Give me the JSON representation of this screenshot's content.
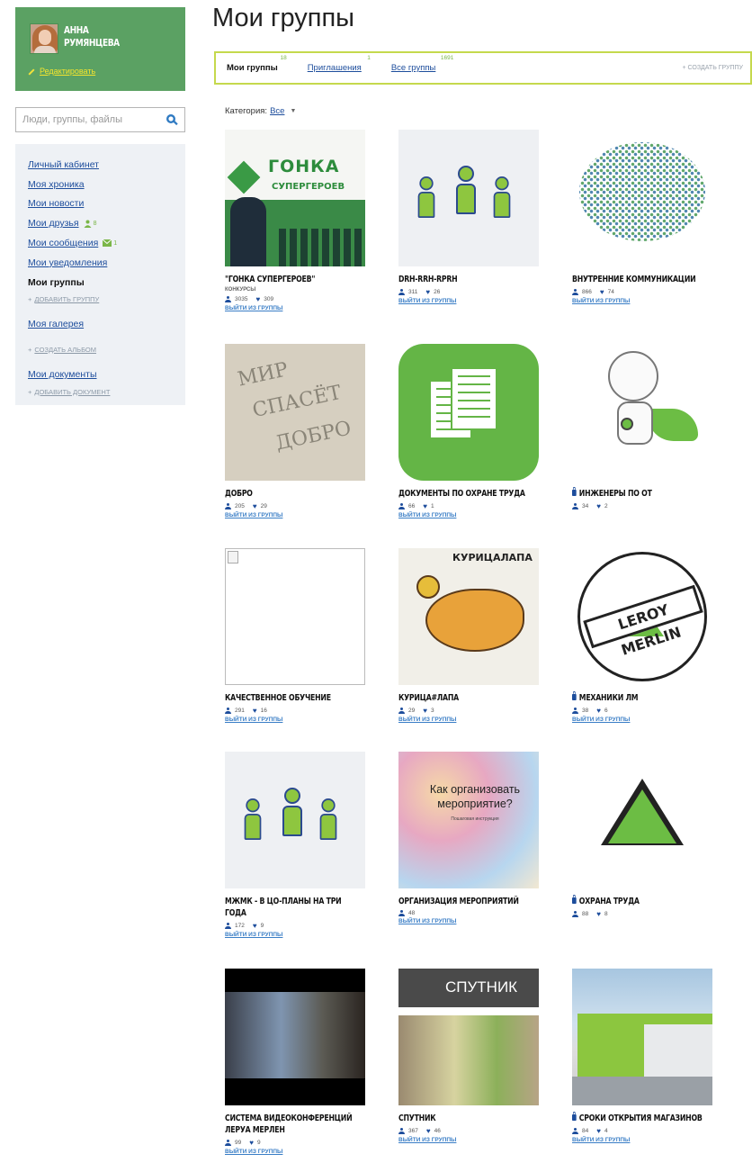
{
  "profile": {
    "name_line1": "АННА",
    "name_line2": "РУМЯНЦЕВА",
    "edit_label": "Редактировать"
  },
  "search": {
    "placeholder": "Люди, группы, файлы"
  },
  "nav": {
    "items": [
      {
        "label": "Личный кабинет"
      },
      {
        "label": "Моя хроника"
      },
      {
        "label": "Мои новости"
      },
      {
        "label": "Мои друзья",
        "badge": "8"
      },
      {
        "label": "Мои сообщения",
        "badge": "1"
      },
      {
        "label": "Мои уведомления"
      },
      {
        "label": "Мои группы"
      }
    ],
    "add_group": "добавить группу",
    "gallery": "Моя галерея",
    "create_album": "создать альбом",
    "documents": "Мои документы",
    "add_document": "добавить документ"
  },
  "page": {
    "title": "Мои группы"
  },
  "tabs": {
    "items": [
      {
        "label": "Мои группы",
        "count": "18"
      },
      {
        "label": "Приглашения",
        "count": "1"
      },
      {
        "label": "Все группы",
        "count": "1691"
      }
    ],
    "create": "+ создать группу"
  },
  "filter": {
    "label": "Категория:",
    "value": "Все"
  },
  "groups": [
    {
      "title": "\"Гонка супергероев\"",
      "subtitle": "конкурсы",
      "members": "3035",
      "likes": "309",
      "leave": "выйти из группы",
      "private": false
    },
    {
      "title": "DRH-RRH-RPRH",
      "members": "311",
      "likes": "26",
      "leave": "выйти из группы",
      "private": false
    },
    {
      "title": "Внутренние коммуникации",
      "members": "866",
      "likes": "74",
      "leave": "выйти из группы",
      "private": false
    },
    {
      "title": "Добро",
      "members": "205",
      "likes": "29",
      "leave": "выйти из группы",
      "private": false
    },
    {
      "title": "Документы по охране труда",
      "members": "66",
      "likes": "1",
      "leave": "выйти из группы",
      "private": false
    },
    {
      "title": "Инженеры по ОТ",
      "members": "34",
      "likes": "2",
      "private": true
    },
    {
      "title": "Качественное обучение",
      "members": "291",
      "likes": "16",
      "leave": "выйти из группы",
      "private": false
    },
    {
      "title": "Курица#лапа",
      "members": "29",
      "likes": "3",
      "leave": "выйти из группы",
      "private": false
    },
    {
      "title": "Механики ЛМ",
      "members": "38",
      "likes": "6",
      "leave": "выйти из группы",
      "private": true
    },
    {
      "title": "МЖМК - в ЦО-планы на три года",
      "members": "172",
      "likes": "9",
      "leave": "выйти из группы",
      "private": false
    },
    {
      "title": "Организация мероприятий",
      "members": "48",
      "leave": "выйти из группы",
      "private": false
    },
    {
      "title": "Охрана труда",
      "members": "88",
      "likes": "8",
      "private": true
    },
    {
      "title": "Система видеоконференций Леруа Мерлен",
      "members": "99",
      "likes": "9",
      "leave": "выйти из группы",
      "private": false
    },
    {
      "title": "Спутник",
      "members": "367",
      "likes": "46",
      "leave": "выйти из группы",
      "private": false
    },
    {
      "title": "Сроки открытия магазинов",
      "members": "84",
      "likes": "4",
      "leave": "выйти из группы",
      "private": true
    }
  ],
  "thumb_text": {
    "gonka_line1": "ГОНКА",
    "gonka_line2": "СУПЕРГЕРОЕВ",
    "dobro_1": "МИР",
    "dobro_2": "СПАСЁТ",
    "dobro_3": "ДОБРО",
    "chicken": "КУРИЦАЛАПА",
    "leroy": "LEROY MERLIN",
    "event_q": "Как организовать мероприятие?",
    "event_s": "Пошаговая инструкция",
    "sputnik": "СПУТНИК"
  },
  "colors": {
    "profile_bg": "#5ba163",
    "accent": "#c5d94d",
    "link": "#1d4d9c",
    "brand_green": "#6cbd44"
  }
}
